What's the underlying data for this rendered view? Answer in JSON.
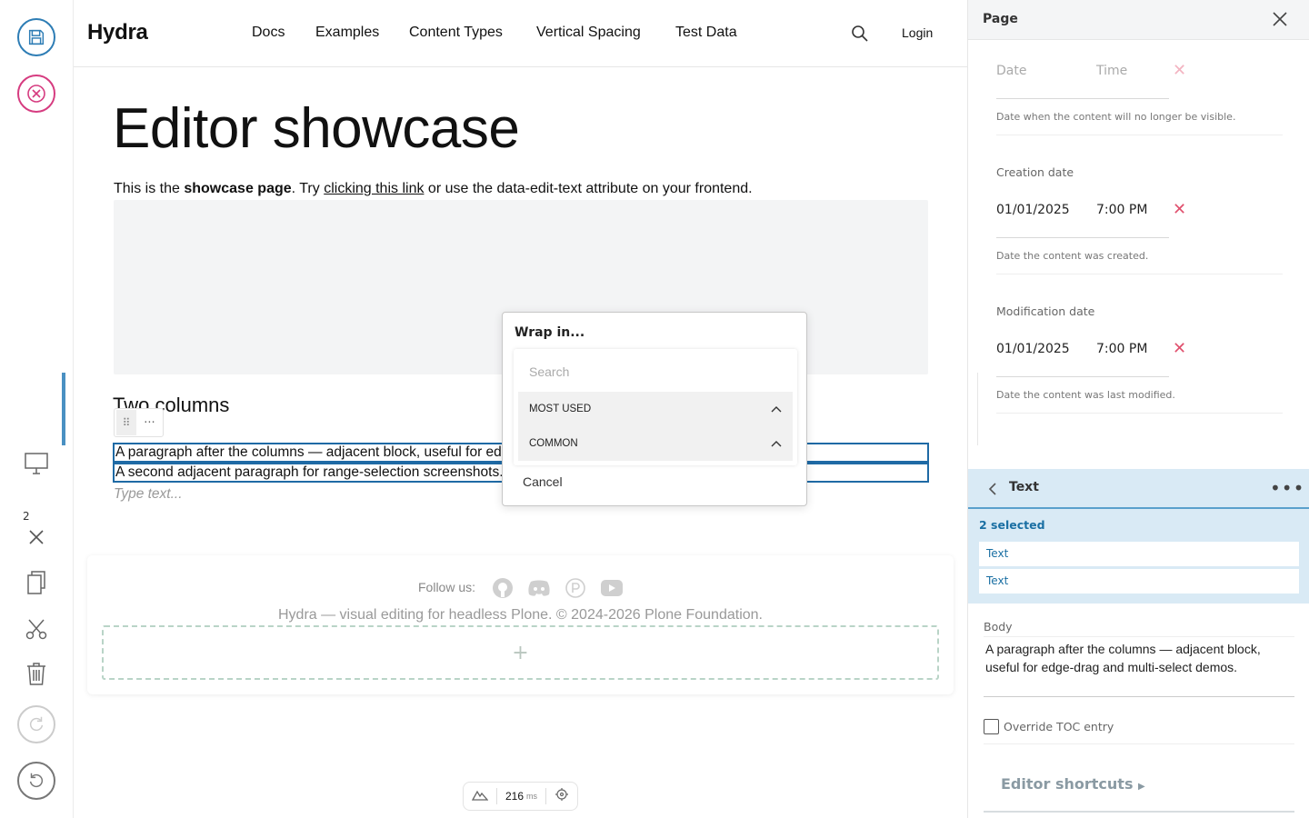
{
  "header": {
    "brand": "Hydra",
    "nav": [
      "Docs",
      "Examples",
      "Content Types",
      "Vertical Spacing",
      "Test Data"
    ],
    "login": "Login"
  },
  "toolbar": {
    "selection_count": "2"
  },
  "page": {
    "title": "Editor showcase",
    "intro_pre": "This is the ",
    "intro_bold": "showcase page",
    "intro_mid": ". Try ",
    "intro_link": "clicking this link",
    "intro_post": " or use the data-edit-text attribute on your frontend.",
    "section_heading": "Two columns",
    "paragraph1": "A paragraph after the columns — adjacent block, useful for edge-drag and multi-select demos.",
    "paragraph2": "A second adjacent paragraph for range-selection screenshots.",
    "type_placeholder": "Type text..."
  },
  "footer": {
    "follow": "Follow us:",
    "copyright": "Hydra — visual editing for headless Plone. © 2024-2026 Plone Foundation.",
    "add": "+"
  },
  "status": {
    "value": "216",
    "unit": "ms"
  },
  "dialog": {
    "title": "Wrap in...",
    "search_placeholder": "Search",
    "sections": [
      "MOST USED",
      "COMMON"
    ],
    "cancel": "Cancel"
  },
  "sidebar": {
    "title": "Page",
    "expiration": {
      "date_placeholder": "Date",
      "time_placeholder": "Time",
      "help": "Date when the content will no longer be visible."
    },
    "creation": {
      "label": "Creation date",
      "date": "01/01/2025",
      "time": "7:00 PM",
      "help": "Date the content was created."
    },
    "modification": {
      "label": "Modification date",
      "date": "01/01/2025",
      "time": "7:00 PM",
      "help": "Date the content was last modified."
    },
    "block": {
      "title": "Text",
      "selected": "2 selected",
      "items": [
        "Text",
        "Text"
      ]
    },
    "body_label": "Body",
    "body_text": "A paragraph after the columns — adjacent block, useful for edge-drag and multi-select demos.",
    "override_toc": "Override TOC entry",
    "shortcuts": "Editor shortcuts"
  },
  "colors": {
    "save": "#2e7db5",
    "cancel": "#d63c80",
    "selection": "#1f6aa5",
    "clear": "#e0516e"
  }
}
